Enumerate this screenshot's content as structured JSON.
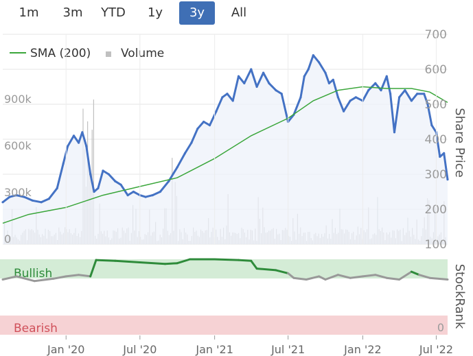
{
  "range_buttons": [
    {
      "label": "1m",
      "active": false
    },
    {
      "label": "3m",
      "active": false
    },
    {
      "label": "YTD",
      "active": false
    },
    {
      "label": "1y",
      "active": false
    },
    {
      "label": "3y",
      "active": true
    },
    {
      "label": "All",
      "active": false
    }
  ],
  "colors": {
    "price": "#4472c4",
    "sma": "#3aa63a",
    "volume": "#c0c0c0",
    "price_fill": "#eef2fa",
    "bullish_band": "#d4ecd6",
    "bearish_band": "#f6d2d4",
    "rank_green": "#2e8b3a",
    "rank_gray": "#999999",
    "active_button": "#3f6fb5"
  },
  "chart_data": [
    {
      "type": "line",
      "legend": [
        "SMA (200)",
        "Volume"
      ],
      "y_axis_title": "Share Price",
      "x_tick_labels": [
        "Jan '20",
        "Jul '20",
        "Jan '21",
        "Jul '21",
        "Jan '22",
        "Jul '22"
      ],
      "x_ticks": [
        "2020-01-01",
        "2020-07-01",
        "2021-01-01",
        "2021-07-01",
        "2022-01-01",
        "2022-07-01"
      ],
      "x_range": [
        "2019-07-29",
        "2022-07-29"
      ],
      "price_ticks": [
        100,
        200,
        300,
        400,
        500,
        600,
        700
      ],
      "price_ylim": [
        100,
        700
      ],
      "volume_ticks": [
        "0",
        "300k",
        "600k",
        "900k"
      ],
      "volume_tick_values": [
        0,
        300000,
        600000,
        900000
      ],
      "volume_ylim": [
        0,
        1350000
      ],
      "grid": true,
      "legend_position": "top-left",
      "series": [
        {
          "name": "Share Price",
          "x": [
            "2019-07-29",
            "2019-08-15",
            "2019-09-01",
            "2019-09-20",
            "2019-10-10",
            "2019-11-01",
            "2019-11-20",
            "2019-12-10",
            "2019-12-25",
            "2020-01-05",
            "2020-01-20",
            "2020-02-01",
            "2020-02-10",
            "2020-02-20",
            "2020-03-01",
            "2020-03-10",
            "2020-03-20",
            "2020-04-01",
            "2020-04-15",
            "2020-05-01",
            "2020-05-15",
            "2020-06-01",
            "2020-06-15",
            "2020-07-01",
            "2020-07-15",
            "2020-08-01",
            "2020-08-20",
            "2020-09-10",
            "2020-10-01",
            "2020-10-20",
            "2020-11-05",
            "2020-11-20",
            "2020-12-05",
            "2020-12-20",
            "2021-01-05",
            "2021-01-20",
            "2021-02-01",
            "2021-02-15",
            "2021-03-01",
            "2021-03-15",
            "2021-04-01",
            "2021-04-15",
            "2021-05-01",
            "2021-05-15",
            "2021-06-01",
            "2021-06-15",
            "2021-07-01",
            "2021-07-15",
            "2021-08-01",
            "2021-08-10",
            "2021-08-20",
            "2021-09-01",
            "2021-09-15",
            "2021-10-01",
            "2021-10-10",
            "2021-10-20",
            "2021-11-01",
            "2021-11-15",
            "2021-12-01",
            "2021-12-15",
            "2022-01-01",
            "2022-01-15",
            "2022-02-01",
            "2022-02-15",
            "2022-03-01",
            "2022-03-10",
            "2022-03-20",
            "2022-04-01",
            "2022-04-15",
            "2022-05-01",
            "2022-05-15",
            "2022-06-01",
            "2022-06-10",
            "2022-06-20",
            "2022-07-01",
            "2022-07-10",
            "2022-07-20",
            "2022-07-29"
          ],
          "y": [
            220,
            235,
            240,
            235,
            225,
            220,
            230,
            260,
            330,
            380,
            410,
            390,
            420,
            380,
            300,
            250,
            260,
            310,
            300,
            280,
            270,
            240,
            250,
            240,
            235,
            240,
            250,
            280,
            320,
            360,
            390,
            430,
            450,
            440,
            480,
            520,
            530,
            510,
            580,
            560,
            600,
            550,
            590,
            560,
            540,
            530,
            450,
            470,
            520,
            580,
            600,
            640,
            620,
            590,
            560,
            570,
            520,
            480,
            510,
            520,
            510,
            540,
            560,
            540,
            580,
            530,
            420,
            520,
            540,
            510,
            530,
            530,
            500,
            440,
            420,
            350,
            360,
            285
          ]
        },
        {
          "name": "SMA (200)",
          "x": [
            "2019-07-29",
            "2019-10-01",
            "2020-01-01",
            "2020-04-01",
            "2020-07-01",
            "2020-10-01",
            "2021-01-01",
            "2021-04-01",
            "2021-07-01",
            "2021-09-01",
            "2021-11-01",
            "2022-01-01",
            "2022-03-01",
            "2022-05-01",
            "2022-06-15",
            "2022-07-29"
          ],
          "y": [
            160,
            185,
            205,
            240,
            265,
            290,
            345,
            410,
            460,
            510,
            540,
            550,
            545,
            545,
            535,
            505
          ]
        }
      ]
    },
    {
      "type": "line",
      "y_axis_title": "StockRank",
      "band_labels": [
        "Bullish",
        "Bearish"
      ],
      "rank_ticks": [
        "0"
      ],
      "ylim": [
        0,
        100
      ],
      "series": [
        {
          "name": "StockRank",
          "x": [
            "2019-07-29",
            "2019-09-01",
            "2019-10-15",
            "2019-12-01",
            "2020-01-01",
            "2020-02-01",
            "2020-03-01",
            "2020-03-15",
            "2020-05-01",
            "2020-07-01",
            "2020-09-01",
            "2020-10-01",
            "2020-11-01",
            "2021-01-01",
            "2021-03-01",
            "2021-04-01",
            "2021-04-15",
            "2021-06-01",
            "2021-07-01",
            "2021-07-15",
            "2021-08-15",
            "2021-09-15",
            "2021-10-01",
            "2021-11-01",
            "2021-12-01",
            "2022-01-01",
            "2022-02-01",
            "2022-03-01",
            "2022-04-01",
            "2022-05-01",
            "2022-05-20",
            "2022-06-15",
            "2022-07-29"
          ],
          "y": [
            74,
            78,
            72,
            75,
            78,
            80,
            78,
            99,
            98,
            96,
            94,
            95,
            100,
            100,
            99,
            98,
            88,
            86,
            82,
            76,
            74,
            78,
            74,
            80,
            76,
            78,
            80,
            76,
            74,
            84,
            80,
            76,
            74
          ]
        }
      ]
    }
  ]
}
